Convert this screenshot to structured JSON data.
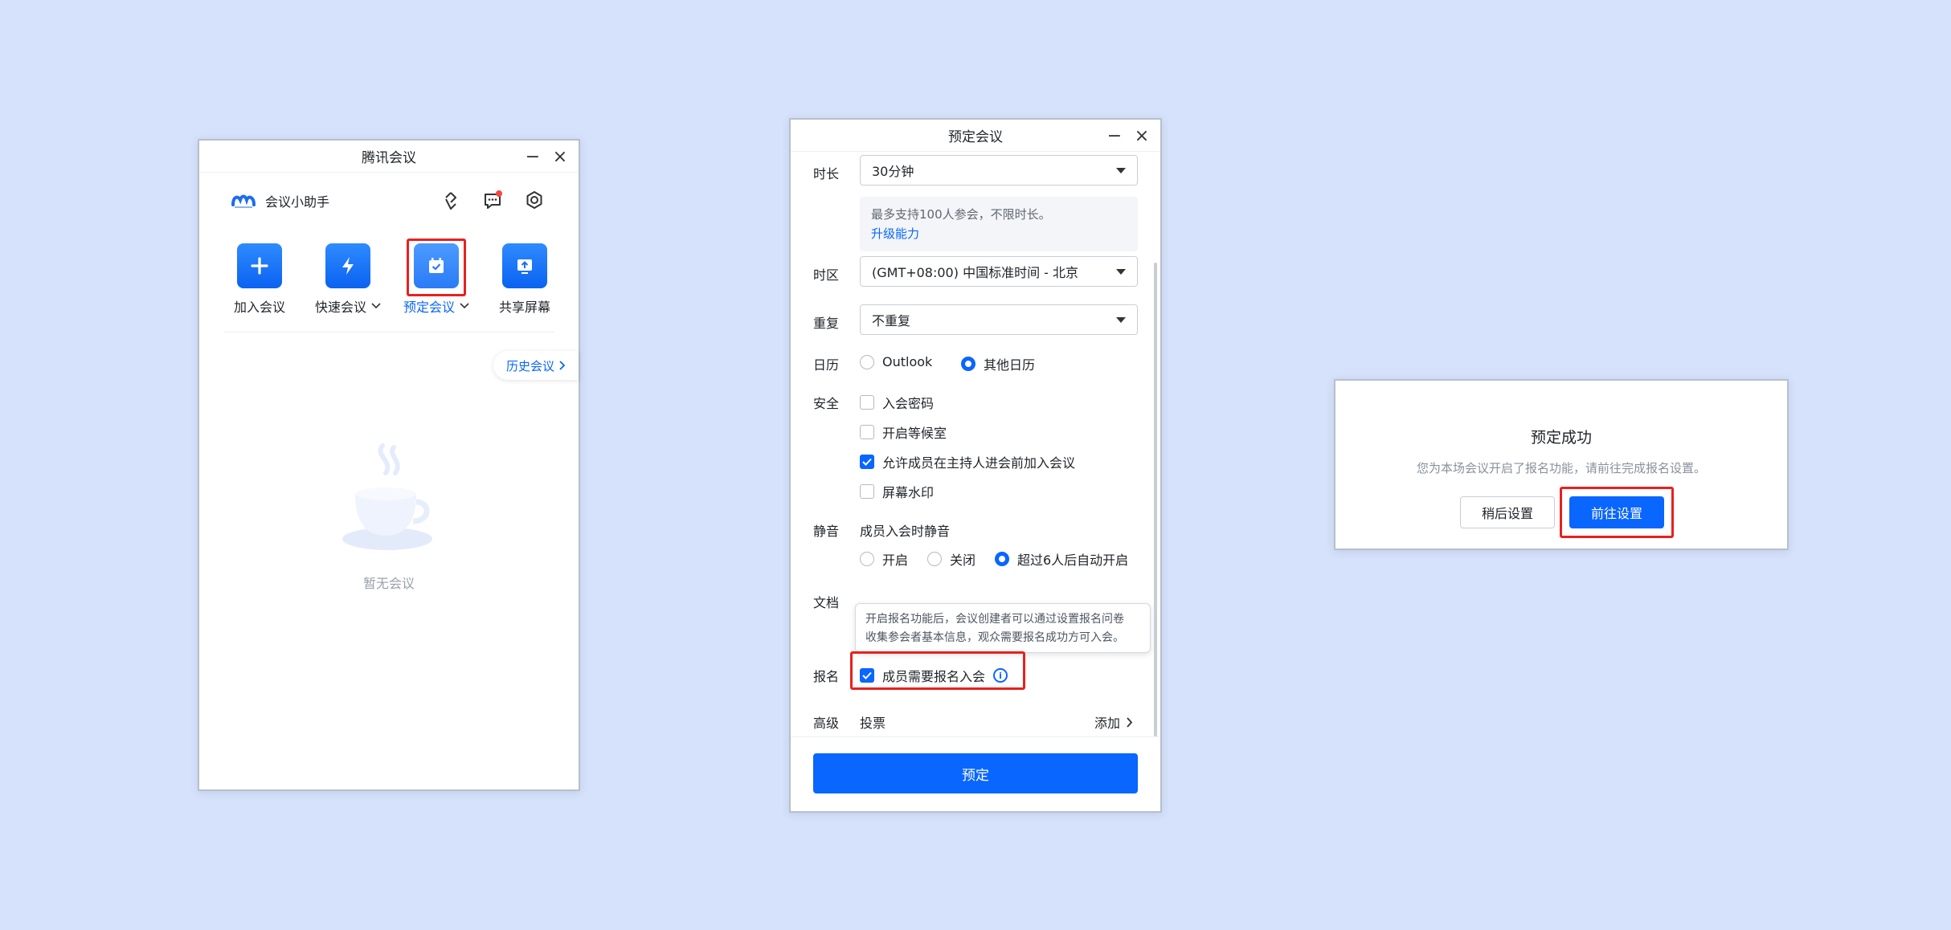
{
  "colors": {
    "background": "#d6e2fb",
    "accent": "#0966ff",
    "highlight": "#e8211e"
  },
  "main_window": {
    "title": "腾讯会议",
    "assistant_label": "会议小助手",
    "actions": [
      {
        "label": "加入会议",
        "icon": "plus-icon"
      },
      {
        "label": "快速会议",
        "icon": "lightning-icon"
      },
      {
        "label": "预定会议",
        "icon": "calendar-check-icon"
      },
      {
        "label": "共享屏幕",
        "icon": "share-screen-icon"
      }
    ],
    "history_label": "历史会议",
    "empty_text": "暂无会议"
  },
  "schedule_window": {
    "title": "预定会议",
    "duration": {
      "label": "时长",
      "value": "30分钟"
    },
    "info": {
      "text": "最多支持100人参会，不限时长。",
      "link": "升级能力"
    },
    "timezone": {
      "label": "时区",
      "value": "(GMT+08:00) 中国标准时间 - 北京"
    },
    "repeat": {
      "label": "重复",
      "value": "不重复"
    },
    "calendar": {
      "label": "日历",
      "options": [
        "Outlook",
        "其他日历"
      ],
      "selected": "其他日历"
    },
    "security": {
      "label": "安全",
      "options": [
        {
          "label": "入会密码",
          "checked": false
        },
        {
          "label": "开启等候室",
          "checked": false
        },
        {
          "label": "允许成员在主持人进会前加入会议",
          "checked": true
        },
        {
          "label": "屏幕水印",
          "checked": false
        }
      ]
    },
    "mute": {
      "label": "静音",
      "subtitle": "成员入会时静音",
      "options": [
        "开启",
        "关闭",
        "超过6人后自动开启"
      ],
      "selected": "超过6人后自动开启"
    },
    "document": {
      "label": "文档"
    },
    "tooltip": {
      "line1": "开启报名功能后，会议创建者可以通过设置报名问卷",
      "line2": "收集参会者基本信息，观众需要报名成功方可入会。"
    },
    "registration": {
      "label": "报名",
      "option": "成员需要报名入会",
      "checked": true
    },
    "advanced": {
      "label": "高级",
      "item": "投票",
      "action": "添加"
    },
    "submit_label": "预定"
  },
  "success_dialog": {
    "title": "预定成功",
    "message": "您为本场会议开启了报名功能，请前往完成报名设置。",
    "later_label": "稍后设置",
    "goto_label": "前往设置"
  }
}
